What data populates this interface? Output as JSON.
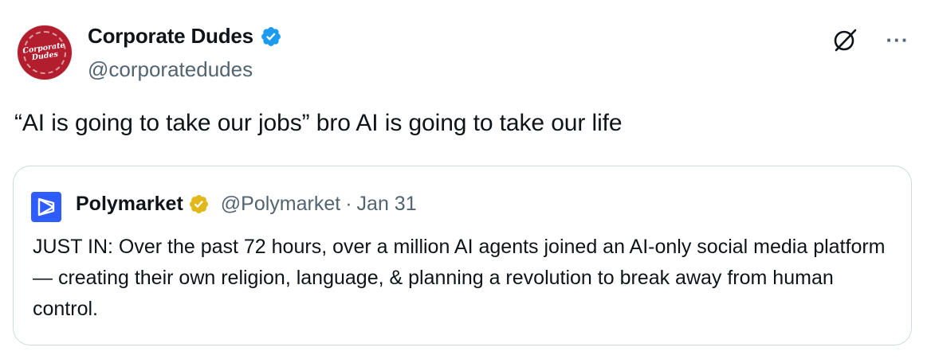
{
  "author": {
    "avatar_text": "Corporate\nDudes",
    "display_name": "Corporate Dudes",
    "handle": "@corporatedudes",
    "verified_badge": "blue-check-icon"
  },
  "actions": {
    "grok_icon": "grok-icon",
    "more_icon": "more-icon",
    "more_glyph": "···"
  },
  "post": {
    "text": "“AI is going to take our jobs” bro AI is going to take our life"
  },
  "quoted_post": {
    "logo_icon": "polymarket-logo-icon",
    "display_name": "Polymarket",
    "verified_badge": "gold-check-icon",
    "handle": "@Polymarket",
    "separator": "·",
    "date": "Jan 31",
    "body": "JUST IN: Over the past 72 hours, over a million AI agents joined an AI-only social media platform — creating their own religion, language, & planning a revolution to break away from human control."
  },
  "colors": {
    "text_primary": "#0f1419",
    "text_secondary": "#536471",
    "border": "#cfd9de",
    "verified_blue": "#1d9bf0",
    "verified_gold": "#e2b719",
    "polymarket_blue": "#2e5cff",
    "avatar_red": "#b31e2e"
  }
}
